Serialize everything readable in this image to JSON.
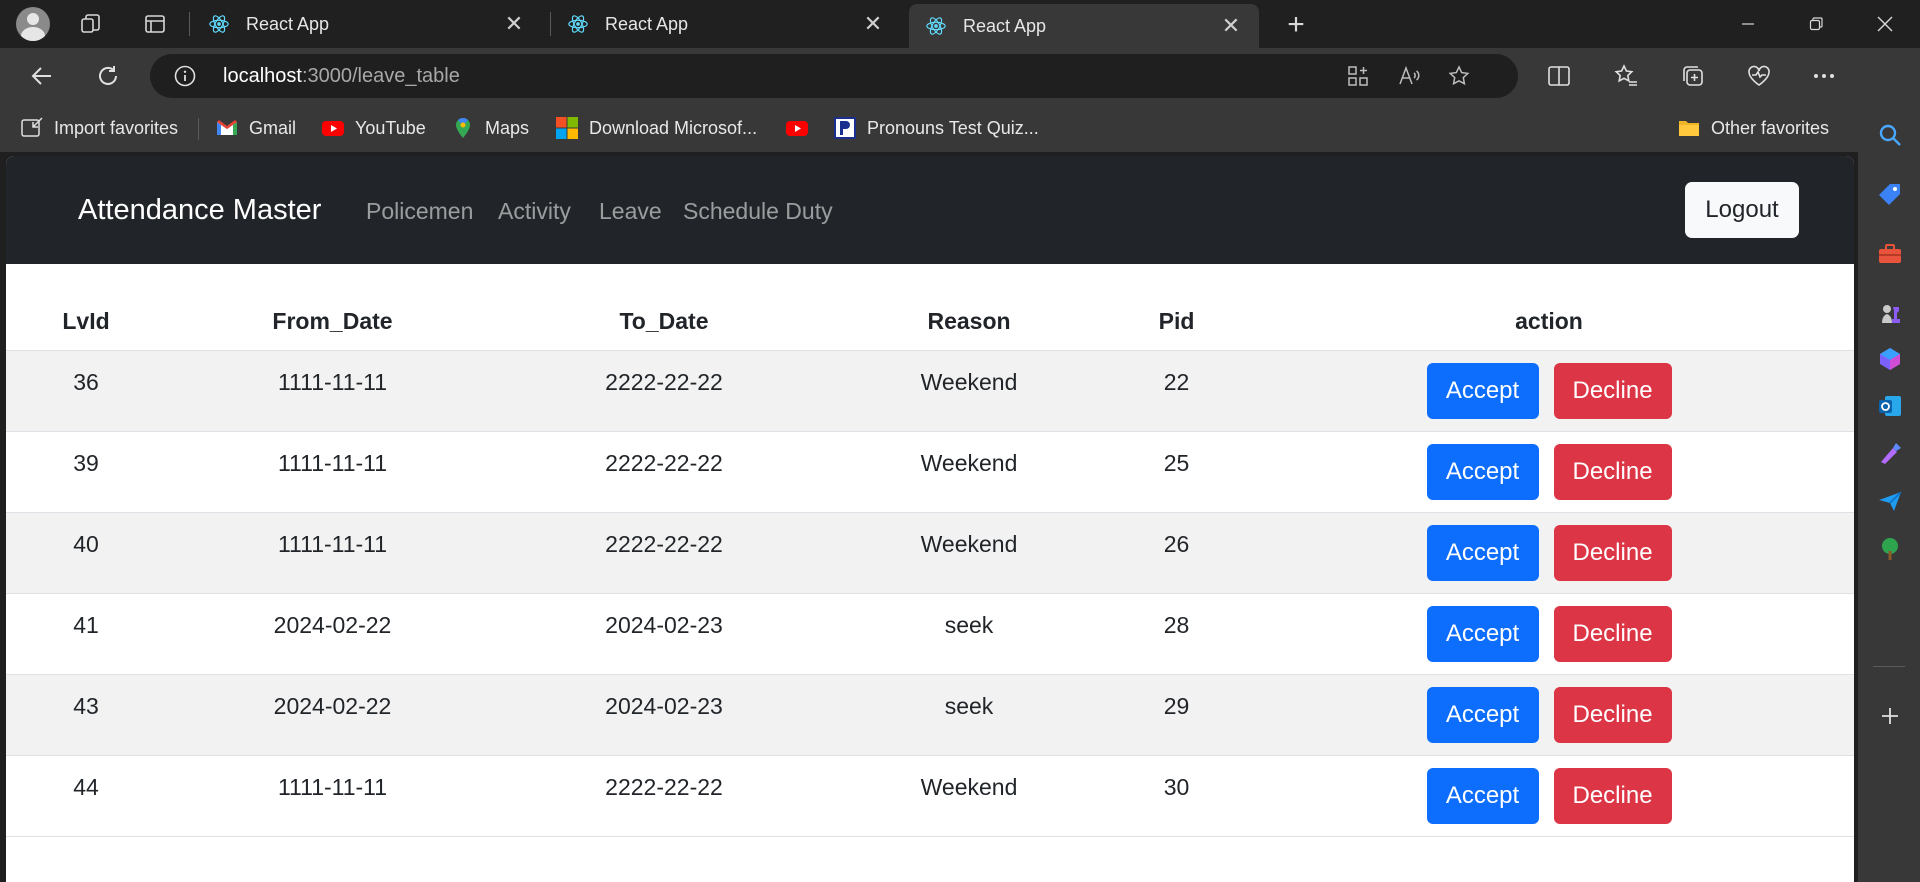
{
  "browser": {
    "tabs": [
      {
        "label": "React App",
        "active": false
      },
      {
        "label": "React App",
        "active": false
      },
      {
        "label": "React App",
        "active": true
      }
    ],
    "url_host": "localhost",
    "url_rest": ":3000/leave_table",
    "favorites": [
      {
        "label": "Import favorites",
        "icon": "import-favorites-icon"
      },
      {
        "label": "Gmail",
        "icon": "gmail-icon"
      },
      {
        "label": "YouTube",
        "icon": "youtube-icon"
      },
      {
        "label": "Maps",
        "icon": "maps-icon"
      },
      {
        "label": "Download Microsof...",
        "icon": "microsoft-icon"
      },
      {
        "label": "Pronouns Test Quiz...",
        "icon": "pronouns-quiz-icon"
      }
    ],
    "other_favorites": "Other favorites"
  },
  "app": {
    "brand": "Attendance Master",
    "nav": [
      "Policemen",
      "Activity",
      "Leave",
      "Schedule Duty"
    ],
    "logout_label": "Logout"
  },
  "table": {
    "headers": [
      "LvId",
      "From_Date",
      "To_Date",
      "Reason",
      "Pid",
      "action"
    ],
    "rows": [
      {
        "lvid": "36",
        "from": "1111-11-11",
        "to": "2222-22-22",
        "reason": "Weekend",
        "pid": "22"
      },
      {
        "lvid": "39",
        "from": "1111-11-11",
        "to": "2222-22-22",
        "reason": "Weekend",
        "pid": "25"
      },
      {
        "lvid": "40",
        "from": "1111-11-11",
        "to": "2222-22-22",
        "reason": "Weekend",
        "pid": "26"
      },
      {
        "lvid": "41",
        "from": "2024-02-22",
        "to": "2024-02-23",
        "reason": "seek",
        "pid": "28"
      },
      {
        "lvid": "43",
        "from": "2024-02-22",
        "to": "2024-02-23",
        "reason": "seek",
        "pid": "29"
      },
      {
        "lvid": "44",
        "from": "1111-11-11",
        "to": "2222-22-22",
        "reason": "Weekend",
        "pid": "30"
      }
    ],
    "accept_label": "Accept",
    "decline_label": "Decline"
  },
  "colors": {
    "navbar": "#212529",
    "accept": "#0d6efd",
    "decline": "#dc3545",
    "stripe": "#f2f2f2"
  }
}
